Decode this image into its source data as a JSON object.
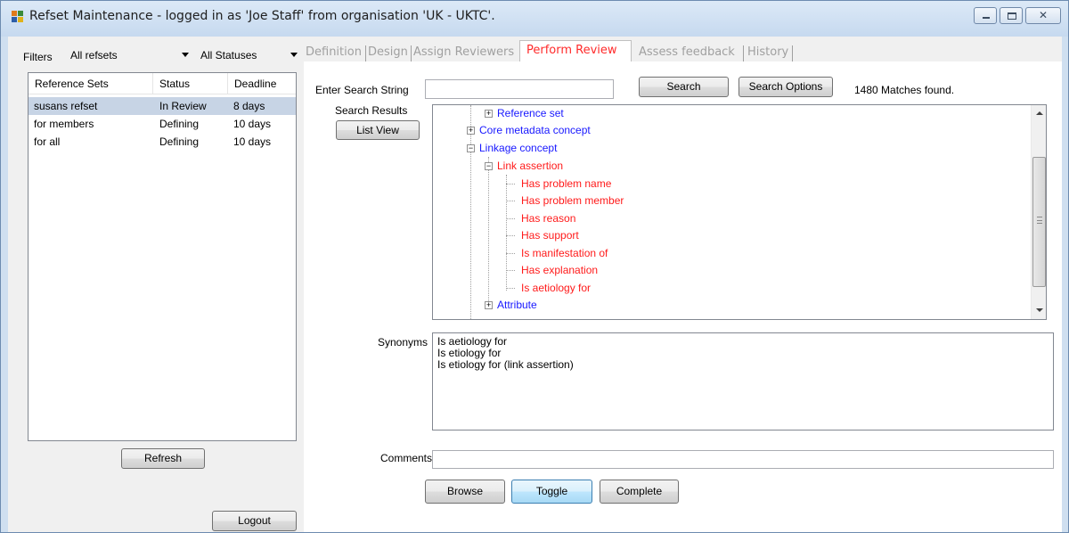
{
  "window": {
    "title": "Refset Maintenance - logged in as 'Joe Staff' from organisation 'UK - UKTC'.",
    "close_glyph": "✕"
  },
  "filters": {
    "label": "Filters",
    "refset_filter": "All refsets",
    "status_filter": "All Statuses"
  },
  "refset_list": {
    "columns": [
      "Reference Sets",
      "Status",
      "Deadline"
    ],
    "rows": [
      {
        "name": "susans refset",
        "status": "In Review",
        "deadline": "8 days"
      },
      {
        "name": "for members",
        "status": "Defining",
        "deadline": "10 days"
      },
      {
        "name": "for all",
        "status": "Defining",
        "deadline": "10 days"
      }
    ]
  },
  "left_buttons": {
    "refresh": "Refresh",
    "logout": "Logout"
  },
  "tabs": [
    "Definition",
    "Design",
    "Assign Reviewers",
    "Perform Review",
    "Assess feedback",
    "History"
  ],
  "search": {
    "label": "Enter Search String",
    "value": "",
    "search_button": "Search",
    "options_button": "Search Options",
    "matches": "1480 Matches found."
  },
  "results": {
    "label": "Search Results",
    "list_view_button": "List View",
    "tree": [
      {
        "label": "Reference set",
        "color": "blue",
        "expander": "+"
      },
      {
        "label": "Core metadata concept",
        "color": "blue",
        "expander": "+"
      },
      {
        "label": "Linkage concept",
        "color": "blue",
        "expander": "-"
      },
      {
        "label": "Link assertion",
        "color": "red",
        "expander": "-"
      },
      {
        "label": "Has problem name",
        "color": "red"
      },
      {
        "label": "Has problem member",
        "color": "red"
      },
      {
        "label": "Has reason",
        "color": "red"
      },
      {
        "label": "Has support",
        "color": "red"
      },
      {
        "label": "Is manifestation of",
        "color": "red"
      },
      {
        "label": "Has explanation",
        "color": "red"
      },
      {
        "label": "Is aetiology for",
        "color": "red"
      },
      {
        "label": "Attribute",
        "color": "blue",
        "expander": "+"
      }
    ]
  },
  "synonyms": {
    "label": "Synonyms",
    "lines": [
      "Is aetiology for",
      "Is etiology for",
      "Is etiology for (link assertion)"
    ]
  },
  "comments": {
    "label": "Comments",
    "value": ""
  },
  "actions": {
    "browse": "Browse",
    "toggle": "Toggle",
    "complete": "Complete"
  },
  "colors": {
    "tree_blue": "#1818ff",
    "tree_red": "#ff1a1a",
    "active_tab": "#ff2a2a",
    "selected_row": "#c7d4e5"
  }
}
